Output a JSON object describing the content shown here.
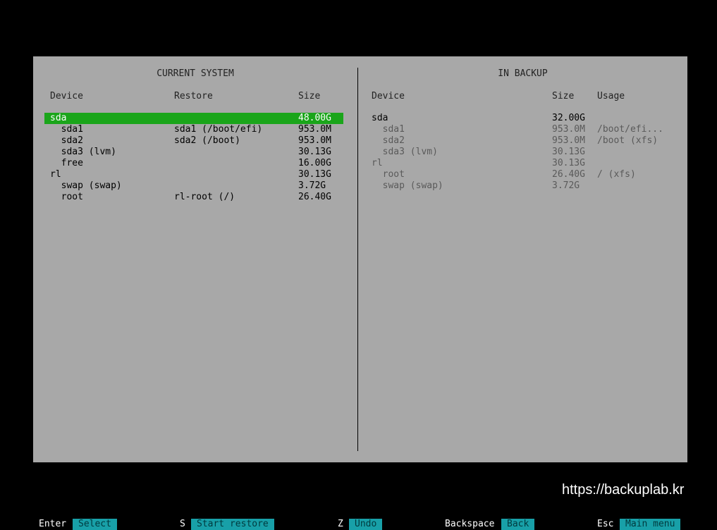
{
  "current_system": {
    "heading": "CURRENT SYSTEM",
    "columns": {
      "device": "Device",
      "restore": "Restore",
      "size": "Size"
    },
    "rows": [
      {
        "device": "sda",
        "restore": "",
        "size": "48.00G",
        "selected": true
      },
      {
        "device": "  sda1",
        "restore": "sda1 (/boot/efi)",
        "size": "953.0M"
      },
      {
        "device": "  sda2",
        "restore": "sda2 (/boot)",
        "size": "953.0M"
      },
      {
        "device": "  sda3 (lvm)",
        "restore": "",
        "size": "30.13G"
      },
      {
        "device": "  free",
        "restore": "",
        "size": "16.00G"
      },
      {
        "device": "rl",
        "restore": "",
        "size": "30.13G"
      },
      {
        "device": "  swap (swap)",
        "restore": "",
        "size": "3.72G"
      },
      {
        "device": "  root",
        "restore": "rl-root (/)",
        "size": "26.40G"
      }
    ]
  },
  "in_backup": {
    "heading": "IN BACKUP",
    "columns": {
      "device": "Device",
      "size": "Size",
      "usage": "Usage"
    },
    "rows": [
      {
        "device": "sda",
        "size": "32.00G",
        "usage": "",
        "dim": false
      },
      {
        "device": "  sda1",
        "size": "953.0M",
        "usage": "/boot/efi...",
        "dim": true
      },
      {
        "device": "  sda2",
        "size": "953.0M",
        "usage": "/boot (xfs)",
        "dim": true
      },
      {
        "device": "  sda3 (lvm)",
        "size": "30.13G",
        "usage": "",
        "dim": true
      },
      {
        "device": "rl",
        "size": "30.13G",
        "usage": "",
        "dim": true
      },
      {
        "device": "  root",
        "size": "26.40G",
        "usage": "/ (xfs)",
        "dim": true
      },
      {
        "device": "  swap (swap)",
        "size": "3.72G",
        "usage": "",
        "dim": true
      }
    ]
  },
  "watermark": "https://backuplab.kr",
  "footer": [
    {
      "key": "Enter",
      "action": "Select"
    },
    {
      "key": "S",
      "action": "Start restore"
    },
    {
      "key": "Z",
      "action": "Undo"
    },
    {
      "key": "Backspace",
      "action": "Back"
    },
    {
      "key": "Esc",
      "action": "Main menu"
    }
  ],
  "colors": {
    "panel": "#a8a8a8",
    "selected": "#1aa51a",
    "action": "#18a0a8",
    "background": "#000000"
  }
}
